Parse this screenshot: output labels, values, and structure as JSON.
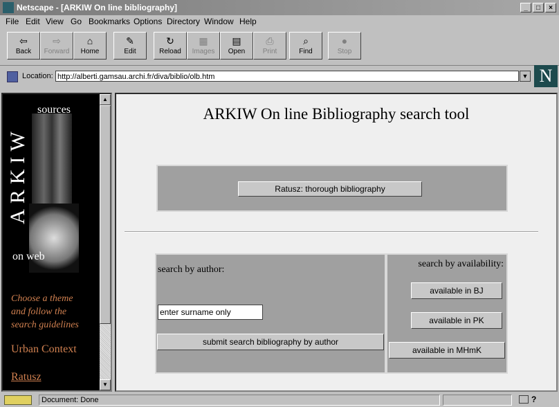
{
  "window": {
    "title": "Netscape - [ARKIW On line bibliography]"
  },
  "menu": [
    "File",
    "Edit",
    "View",
    "Go",
    "Bookmarks",
    "Options",
    "Directory",
    "Window",
    "Help"
  ],
  "toolbar": [
    {
      "label": "Back",
      "icon": "⇦",
      "enabled": true
    },
    {
      "label": "Forward",
      "icon": "⇨",
      "enabled": false
    },
    {
      "label": "Home",
      "icon": "⌂",
      "enabled": true
    },
    {
      "label": "Edit",
      "icon": "✎",
      "enabled": true
    },
    {
      "label": "Reload",
      "icon": "↻",
      "enabled": true
    },
    {
      "label": "Images",
      "icon": "▦",
      "enabled": false
    },
    {
      "label": "Open",
      "icon": "▤",
      "enabled": true
    },
    {
      "label": "Print",
      "icon": "⎙",
      "enabled": false
    },
    {
      "label": "Find",
      "icon": "⌕",
      "enabled": true
    },
    {
      "label": "Stop",
      "icon": "●",
      "enabled": false
    }
  ],
  "location": {
    "label": "Location:",
    "url": "http://alberti.gamsau.archi.fr/diva/biblio/olb.htm"
  },
  "logo": {
    "letter": "N"
  },
  "sidebar": {
    "sources": "sources",
    "brand": "ARKIW",
    "on_web": "on web",
    "prompt_line1": "Choose a theme",
    "prompt_line2": "and follow the",
    "prompt_line3": "search guidelines",
    "link1": "Urban Context",
    "link2": "Ratusz"
  },
  "main": {
    "heading": "ARKIW On line Bibliography  search tool",
    "ratusz_button": "Ratusz: thorough bibliography",
    "author_label": "search by author:",
    "author_input_value": "enter surname only",
    "submit_button": "submit search bibliography by author",
    "availability_label": "search by availability:",
    "avail_bj": "available in BJ",
    "avail_pk": "available in PK",
    "avail_mhmk": "available in MHmK"
  },
  "status": {
    "text": "Document: Done"
  }
}
